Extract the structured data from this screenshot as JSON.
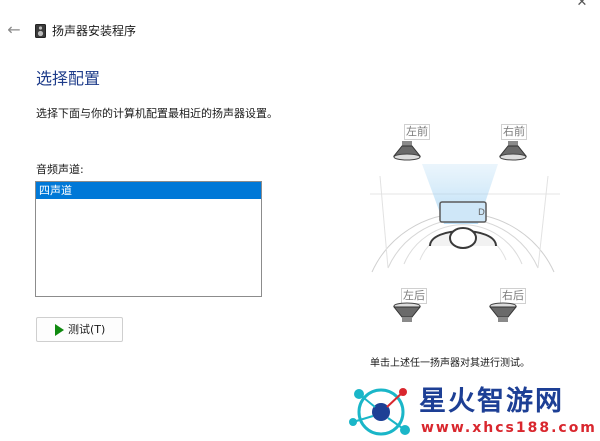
{
  "window": {
    "title": "扬声器安装程序",
    "back_glyph": "←",
    "close_glyph": "✕",
    "icons": [
      "back-arrow-icon",
      "speaker-app-icon",
      "close-icon"
    ]
  },
  "page": {
    "heading": "选择配置",
    "description": "选择下面与你的计算机配置最相近的扬声器设置。"
  },
  "channels": {
    "label": "音频声道:",
    "options": [
      "四声道"
    ],
    "selected": "四声道"
  },
  "test_button": {
    "label": "测试(T)",
    "icon": "play-icon"
  },
  "diagram": {
    "front_left": "左前",
    "front_right": "右前",
    "rear_left": "左后",
    "rear_right": "右后",
    "hint": "单击上述任一扬声器对其进行测试。"
  },
  "watermark": {
    "brand": "星火智游网",
    "url": "www.xhcs188.com"
  },
  "colors": {
    "heading": "#1e3c8a",
    "selection": "#0078d7",
    "play": "#108a10",
    "watermark_blue": "#1d3f95",
    "watermark_red": "#d9272e"
  }
}
